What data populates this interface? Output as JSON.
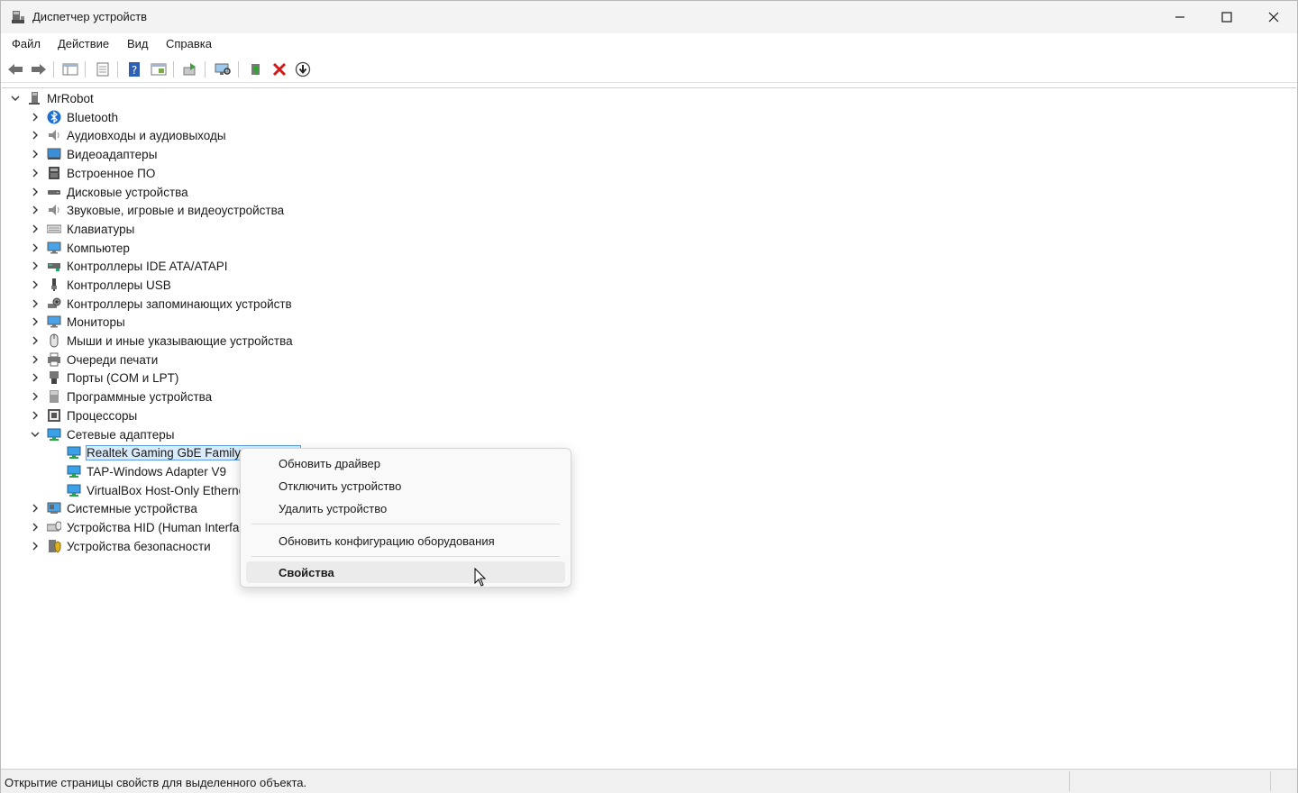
{
  "window": {
    "title": "Диспетчер устройств"
  },
  "menu": [
    "Файл",
    "Действие",
    "Вид",
    "Справка"
  ],
  "toolbar": [
    "back-icon",
    "forward-icon",
    "show-hide-tree-icon",
    "properties-icon",
    "help-icon",
    "action-view-icon",
    "refresh-icon",
    "scan-hardware-icon",
    "update-driver-icon",
    "uninstall-icon",
    "disable-icon"
  ],
  "tree": {
    "root": "MrRobot",
    "categories": [
      {
        "label": "Bluetooth",
        "icon": "bluetooth-icon"
      },
      {
        "label": "Аудиовходы и аудиовыходы",
        "icon": "speaker-icon"
      },
      {
        "label": "Видеоадаптеры",
        "icon": "display-adapter-icon"
      },
      {
        "label": "Встроенное ПО",
        "icon": "firmware-icon"
      },
      {
        "label": "Дисковые устройства",
        "icon": "disk-icon"
      },
      {
        "label": "Звуковые, игровые и видеоустройства",
        "icon": "speaker-icon"
      },
      {
        "label": "Клавиатуры",
        "icon": "keyboard-icon"
      },
      {
        "label": "Компьютер",
        "icon": "monitor-icon"
      },
      {
        "label": "Контроллеры IDE ATA/ATAPI",
        "icon": "ide-icon"
      },
      {
        "label": "Контроллеры USB",
        "icon": "usb-icon"
      },
      {
        "label": "Контроллеры запоминающих устройств",
        "icon": "storage-icon"
      },
      {
        "label": "Мониторы",
        "icon": "monitor-icon"
      },
      {
        "label": "Мыши и иные указывающие устройства",
        "icon": "mouse-icon"
      },
      {
        "label": "Очереди печати",
        "icon": "printer-icon"
      },
      {
        "label": "Порты (COM и LPT)",
        "icon": "port-icon"
      },
      {
        "label": "Программные устройства",
        "icon": "software-device-icon"
      },
      {
        "label": "Процессоры",
        "icon": "cpu-icon"
      },
      {
        "label": "Сетевые адаптеры",
        "icon": "network-icon",
        "expanded": true
      }
    ],
    "network_children": [
      {
        "label": "Realtek Gaming GbE Family Controller",
        "selected": true
      },
      {
        "label": "TAP-Windows Adapter V9"
      },
      {
        "label": "VirtualBox Host-Only Ethernet Adapter"
      }
    ],
    "after": [
      {
        "label": "Системные устройства",
        "icon": "system-icon"
      },
      {
        "label": "Устройства HID (Human Interface Devices)",
        "icon": "hid-icon"
      },
      {
        "label": "Устройства безопасности",
        "icon": "security-icon"
      }
    ]
  },
  "context_menu": {
    "update_driver": "Обновить драйвер",
    "disable_device": "Отключить устройство",
    "uninstall_device": "Удалить устройство",
    "scan_hardware": "Обновить конфигурацию оборудования",
    "properties": "Свойства"
  },
  "status": {
    "text": "Открытие страницы свойств для выделенного объекта."
  },
  "colors": {
    "selection": "#d9ebfb",
    "selection_border": "#5aa0e0",
    "accent": "#0078d4"
  }
}
